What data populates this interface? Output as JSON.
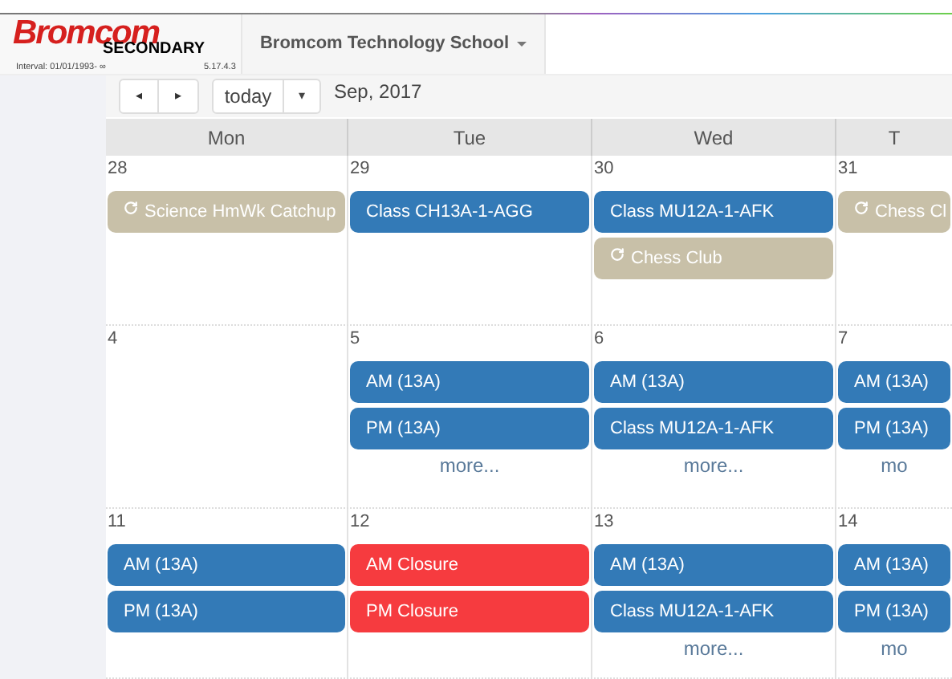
{
  "brand": {
    "logo": "Bromcom",
    "product": "SECONDARY",
    "interval": "Interval: 01/01/1993- ∞",
    "version": "5.17.4.3"
  },
  "school_menu": {
    "label": "Bromcom Technology School"
  },
  "toolbar": {
    "prev": "◂",
    "next": "▸",
    "today": "today",
    "dropdown": "▾",
    "title": "Sep, 2017"
  },
  "columns": [
    "Mon",
    "Tue",
    "Wed",
    "T"
  ],
  "weeks": [
    {
      "days": [
        {
          "date": "28",
          "events": [
            {
              "kind": "club",
              "title": "Science HmWk Catchup"
            }
          ]
        },
        {
          "date": "29",
          "events": [
            {
              "kind": "class",
              "title": "Class CH13A-1-AGG"
            }
          ]
        },
        {
          "date": "30",
          "events": [
            {
              "kind": "class",
              "title": "Class MU12A-1-AFK"
            },
            {
              "kind": "club",
              "title": "Chess Club"
            }
          ]
        },
        {
          "date": "31",
          "events": [
            {
              "kind": "club",
              "title": "Chess Cl"
            }
          ]
        }
      ]
    },
    {
      "days": [
        {
          "date": "4"
        },
        {
          "date": "5",
          "events": [
            {
              "kind": "class",
              "title": "AM (13A)"
            },
            {
              "kind": "class",
              "title": "PM (13A)"
            }
          ],
          "more": "more..."
        },
        {
          "date": "6",
          "events": [
            {
              "kind": "class",
              "title": "AM (13A)"
            },
            {
              "kind": "class",
              "title": "Class MU12A-1-AFK"
            }
          ],
          "more": "more..."
        },
        {
          "date": "7",
          "events": [
            {
              "kind": "class",
              "title": "AM (13A)"
            },
            {
              "kind": "class",
              "title": "PM (13A)"
            }
          ],
          "more": "mo"
        }
      ]
    },
    {
      "days": [
        {
          "date": "11",
          "events": [
            {
              "kind": "class",
              "title": "AM (13A)"
            },
            {
              "kind": "class",
              "title": "PM (13A)"
            }
          ]
        },
        {
          "date": "12",
          "events": [
            {
              "kind": "closure",
              "title": "AM Closure"
            },
            {
              "kind": "closure",
              "title": "PM Closure"
            }
          ]
        },
        {
          "date": "13",
          "events": [
            {
              "kind": "class",
              "title": "AM (13A)"
            },
            {
              "kind": "class",
              "title": "Class MU12A-1-AFK"
            }
          ],
          "more": "more..."
        },
        {
          "date": "14",
          "events": [
            {
              "kind": "class",
              "title": "AM (13A)"
            },
            {
              "kind": "class",
              "title": "PM (13A)"
            }
          ],
          "more": "mo"
        }
      ]
    }
  ]
}
